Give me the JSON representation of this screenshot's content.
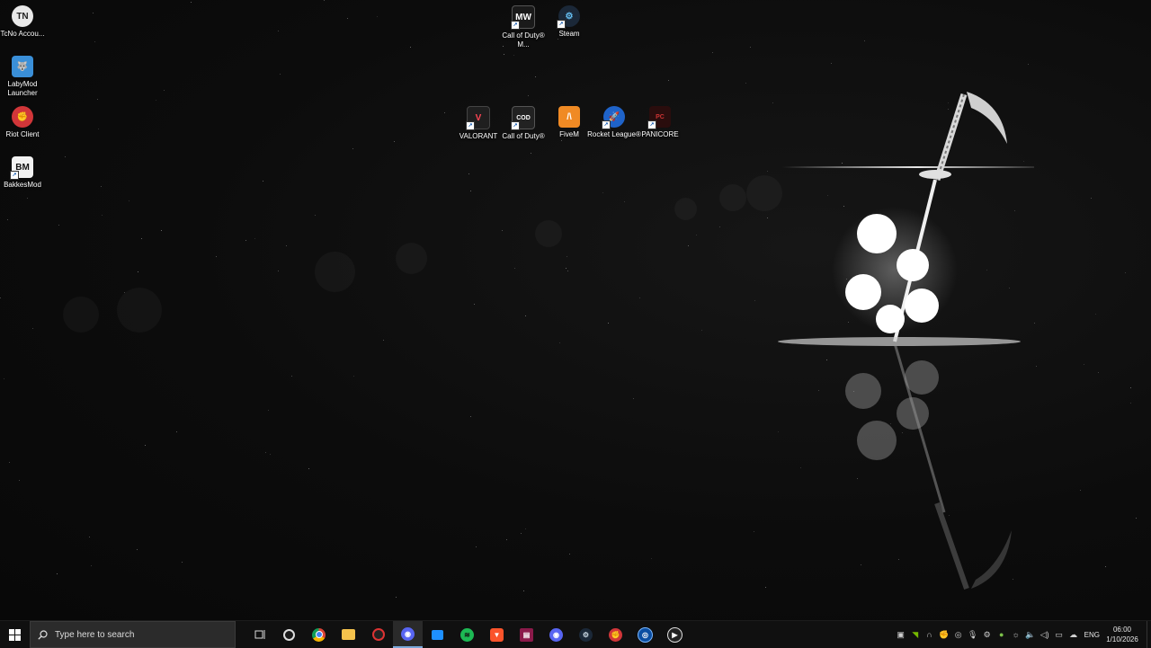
{
  "desktop": {
    "icons": [
      {
        "label": "TcNo Accou...",
        "icon": "tcno-icon",
        "color": "#e8e8e8"
      },
      {
        "label": "LabyMod Launcher",
        "icon": "labymod-icon",
        "color": "#3a8fd8"
      },
      {
        "label": "Riot Client",
        "icon": "riot-icon",
        "color": "#d13639"
      },
      {
        "label": "BakkesMod",
        "icon": "bakkesmod-icon",
        "color": "#f2f2f2"
      },
      {
        "label": "Call of Duty® M...",
        "icon": "cod-mw-icon",
        "color": "#1a1a1a"
      },
      {
        "label": "Steam",
        "icon": "steam-icon",
        "color": "#1b2838"
      },
      {
        "label": "VALORANT",
        "icon": "valorant-icon",
        "color": "#1f1f1f"
      },
      {
        "label": "Call of Duty®",
        "icon": "cod-icon",
        "color": "#222222"
      },
      {
        "label": "FiveM",
        "icon": "fivem-icon",
        "color": "#f08a24"
      },
      {
        "label": "Rocket League®",
        "icon": "rocket-league-icon",
        "color": "#1f63c9"
      },
      {
        "label": "PANICORE",
        "icon": "panicore-icon",
        "color": "#2a0d0d"
      }
    ]
  },
  "taskbar": {
    "search_placeholder": "Type here to search",
    "apps": [
      {
        "name": "task-view",
        "icon": "task-view-icon"
      },
      {
        "name": "steelseries",
        "icon": "steelseries-icon"
      },
      {
        "name": "chrome",
        "icon": "chrome-icon"
      },
      {
        "name": "file-explorer",
        "icon": "folder-icon"
      },
      {
        "name": "app-red-circle",
        "icon": "red-circle-icon"
      },
      {
        "name": "discord-ptb",
        "icon": "discord-icon"
      },
      {
        "name": "app-blue-window",
        "icon": "blue-window-icon"
      },
      {
        "name": "spotify",
        "icon": "spotify-icon"
      },
      {
        "name": "brave",
        "icon": "brave-icon"
      },
      {
        "name": "winrar",
        "icon": "winrar-icon"
      },
      {
        "name": "discord",
        "icon": "discord-icon"
      },
      {
        "name": "steam",
        "icon": "steam-icon"
      },
      {
        "name": "riot-client",
        "icon": "riot-icon"
      },
      {
        "name": "app-outline",
        "icon": "outline-app-icon"
      },
      {
        "name": "media-player",
        "icon": "play-icon"
      }
    ],
    "tray": {
      "language": "ENG",
      "time": "06:00",
      "date": "1/10/2026"
    }
  },
  "colors": {
    "accent": "#7aa7d9",
    "taskbar_bg": "#101010",
    "desktop_bg": "#0b0b0b"
  }
}
